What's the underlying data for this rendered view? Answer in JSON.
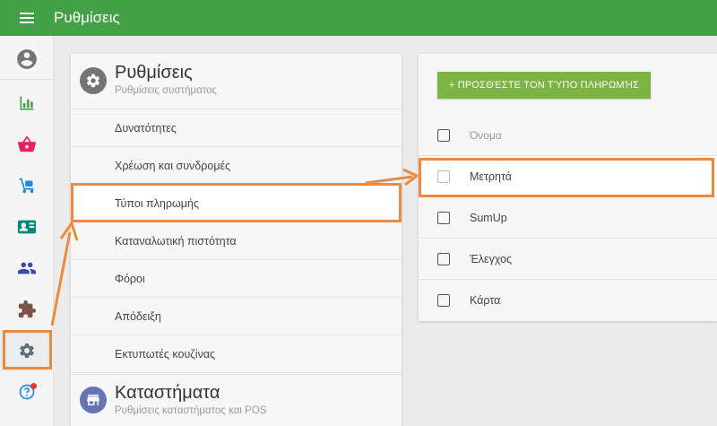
{
  "app": {
    "title": "Ρυθμίσεις"
  },
  "rail": {
    "items": [
      {
        "icon": "account-circle-icon",
        "color": "#757575"
      },
      {
        "icon": "bar-chart-icon",
        "color": "#43a047"
      },
      {
        "icon": "basket-icon",
        "color": "#e91e63"
      },
      {
        "icon": "hand-truck-icon",
        "color": "#1e88e5"
      },
      {
        "icon": "contact-card-icon",
        "color": "#00897b"
      },
      {
        "icon": "people-icon",
        "color": "#3949ab"
      },
      {
        "icon": "puzzle-icon",
        "color": "#795548"
      },
      {
        "icon": "gear-icon",
        "color": "#5c6f7c"
      },
      {
        "icon": "help-icon",
        "color": "#1e88e5"
      }
    ]
  },
  "settings": {
    "title": "Ρυθμίσεις",
    "subtitle": "Ρυθμίσεις συστήματος",
    "items": [
      {
        "label": "Δυνατότητες"
      },
      {
        "label": "Χρέωση και συνδρομές"
      },
      {
        "label": "Τύποι πληρωμής",
        "selected": true
      },
      {
        "label": "Καταναλωτική πιστότητα"
      },
      {
        "label": "Φόροι"
      },
      {
        "label": "Απόδειξη"
      },
      {
        "label": "Εκτυπωτές κουζίνας"
      }
    ]
  },
  "stores": {
    "title": "Καταστήματα",
    "subtitle": "Ρυθμίσεις καταστήματος και POS"
  },
  "payment_types": {
    "add_button": "+ ΠΡΟΣΘΈΣΤΕ ΤΟΝ ΤΎΠΟ ΠΛΗΡΩΜΉΣ",
    "column_header": "Όνομα",
    "rows": [
      {
        "name": "Μετρητά"
      },
      {
        "name": "SumUp"
      },
      {
        "name": "Έλεγχος"
      },
      {
        "name": "Κάρτα"
      }
    ]
  },
  "colors": {
    "topbar": "#43a047",
    "accent_highlight": "#ee8a3d",
    "add_button": "#7cb342"
  }
}
